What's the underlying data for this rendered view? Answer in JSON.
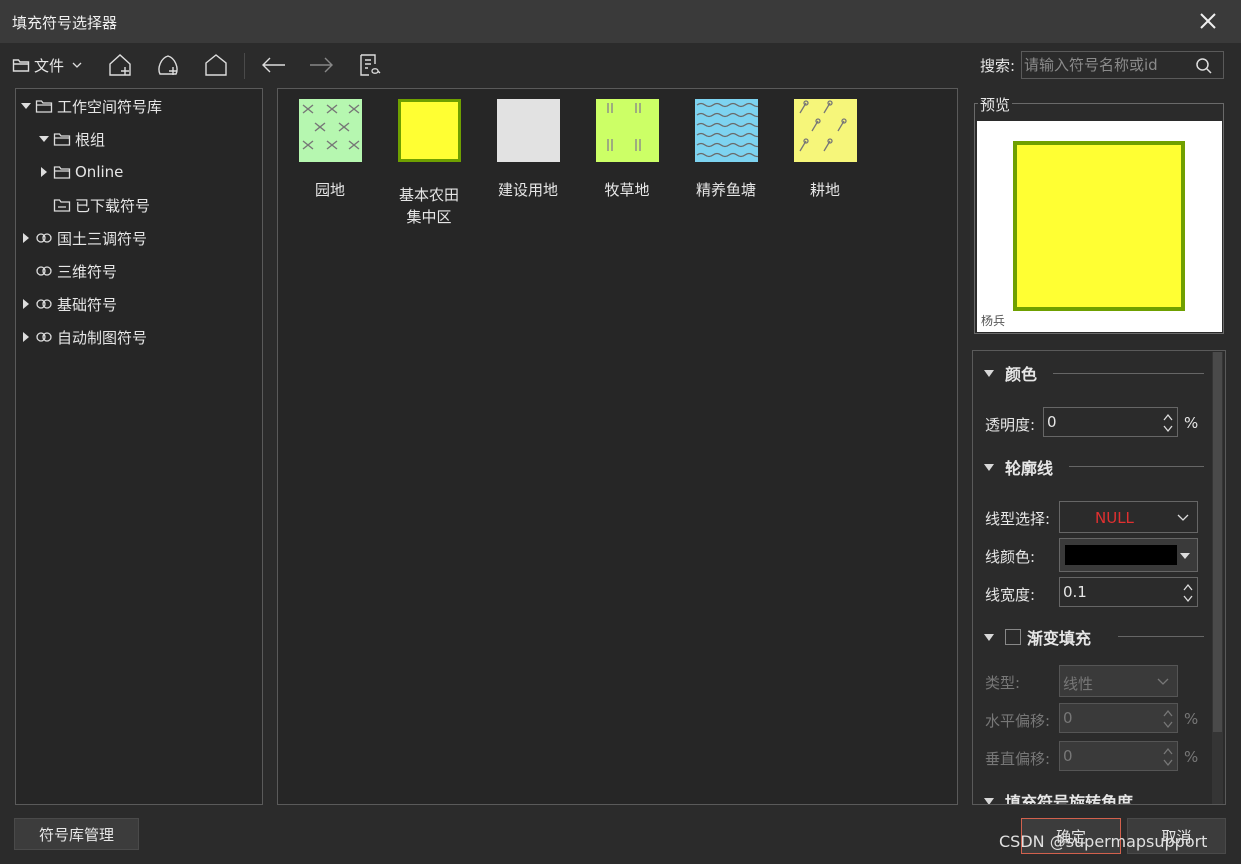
{
  "window": {
    "title": "填充符号选择器"
  },
  "toolbar": {
    "file_label": "文件",
    "search_label": "搜索:",
    "search_placeholder": "请输入符号名称或id"
  },
  "tree": {
    "items": [
      {
        "label": "工作空间符号库"
      },
      {
        "label": "根组"
      },
      {
        "label": "Online"
      },
      {
        "label": "已下载符号"
      },
      {
        "label": "国土三调符号"
      },
      {
        "label": "三维符号"
      },
      {
        "label": "基础符号"
      },
      {
        "label": "自动制图符号"
      }
    ]
  },
  "symbols": [
    {
      "label": "园地",
      "bg": "#b6f7b0"
    },
    {
      "label": "基本农田集中区",
      "bg": "#ffff33"
    },
    {
      "label": "建设用地",
      "bg": "#e2e2e2"
    },
    {
      "label": "牧草地",
      "bg": "#ccff66"
    },
    {
      "label": "精养鱼塘",
      "bg": "#7dd3f0"
    },
    {
      "label": "耕地",
      "bg": "#f6f67a"
    }
  ],
  "preview": {
    "title": "预览",
    "caption": "杨兵",
    "fill_color": "#ffff33",
    "stroke_color": "#6fa000"
  },
  "props": {
    "color_section": "颜色",
    "transparency_label": "透明度:",
    "transparency_value": "0",
    "percent": "%",
    "outline_section": "轮廓线",
    "line_type_label": "线型选择:",
    "line_type_value": "NULL",
    "line_color_label": "线颜色:",
    "line_width_label": "线宽度:",
    "line_width_value": "0.1",
    "gradient_section": "渐变填充",
    "type_label": "类型:",
    "type_value": "线性",
    "h_offset_label": "水平偏移:",
    "h_offset_value": "0",
    "v_offset_label": "垂直偏移:",
    "v_offset_value": "0",
    "rotation_section": "填充符号旋转角度"
  },
  "buttons": {
    "manage": "符号库管理",
    "ok": "确定",
    "cancel": "取消"
  },
  "watermark": "CSDN @supermapsupport"
}
